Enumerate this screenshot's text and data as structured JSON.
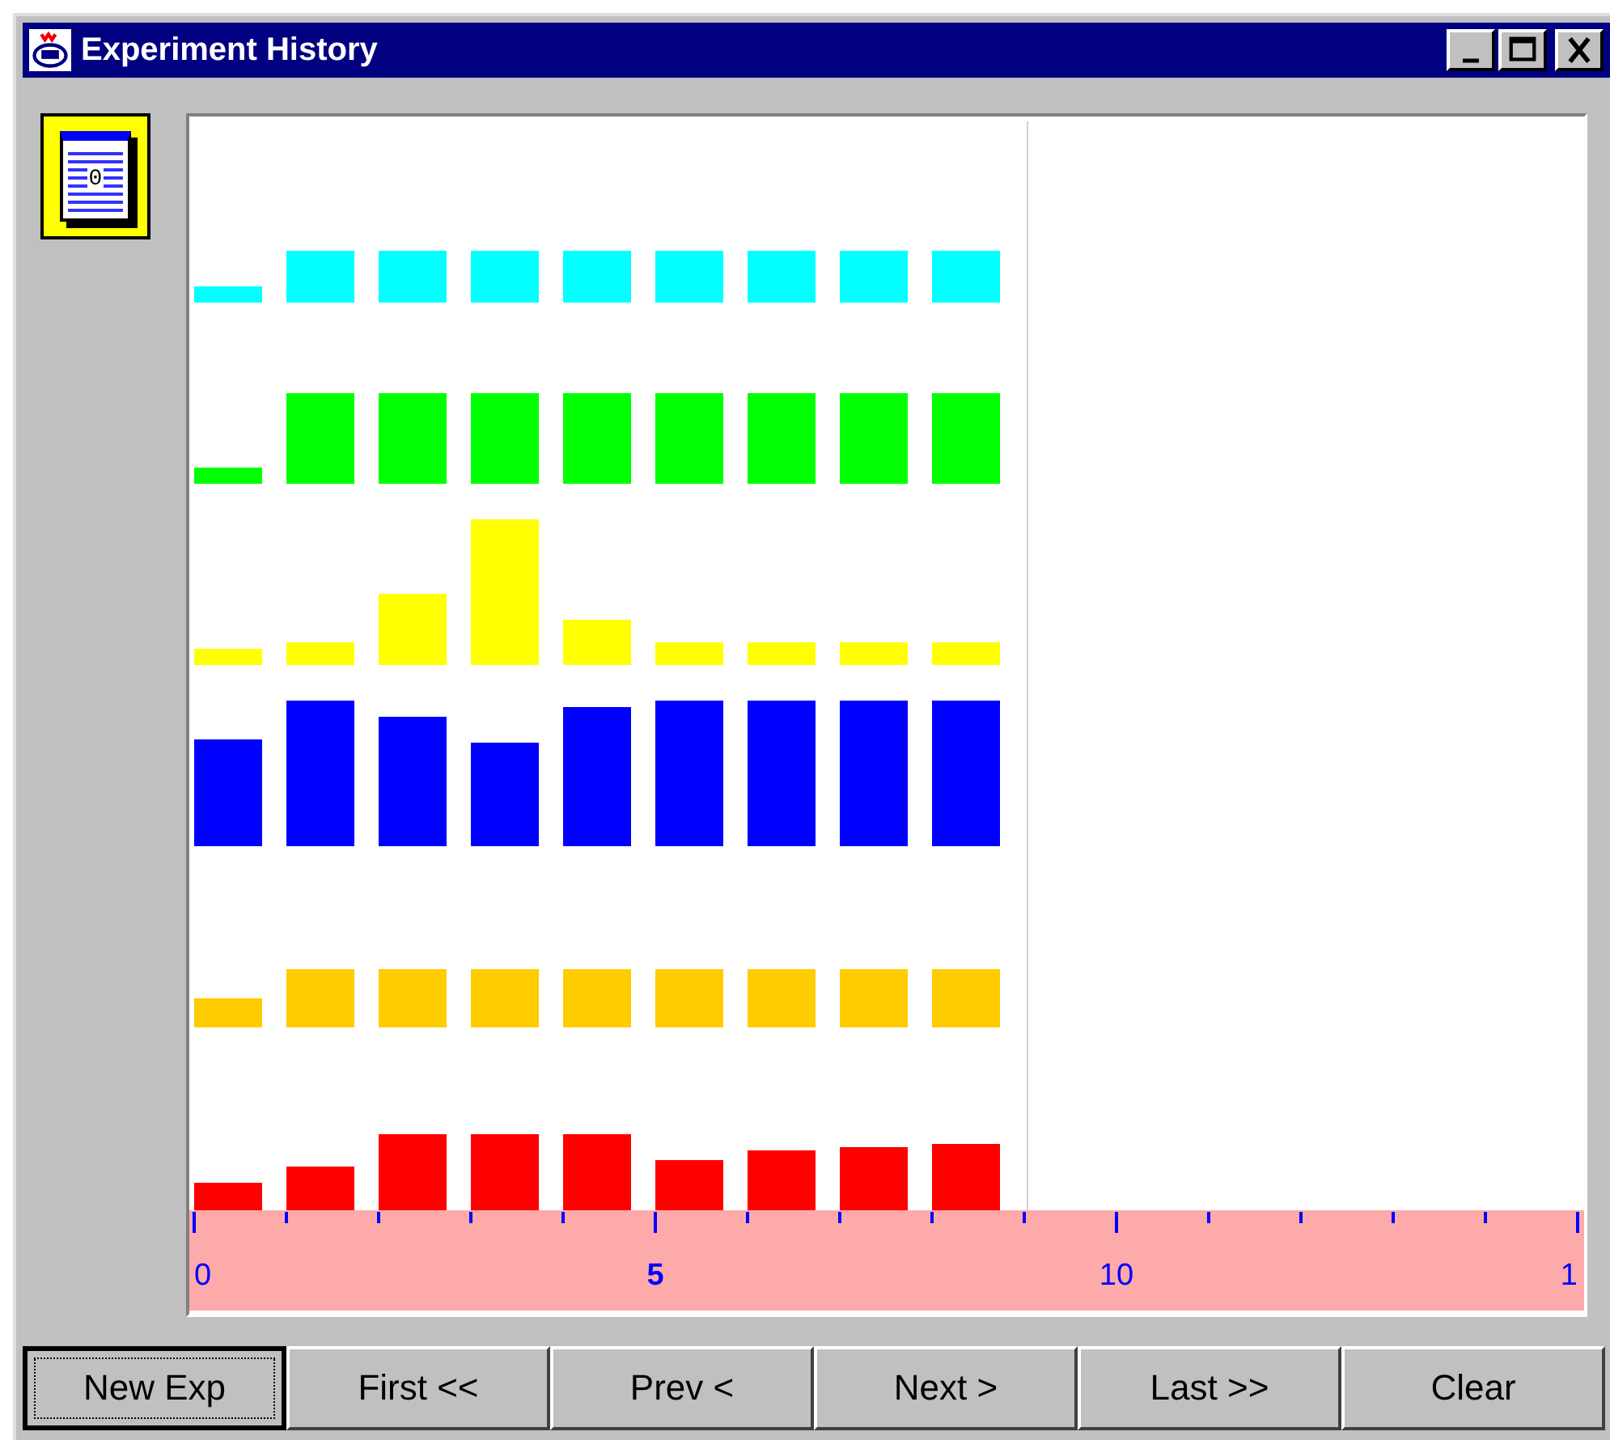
{
  "window": {
    "title": "Experiment History"
  },
  "notebook_icon": {
    "label": "0"
  },
  "chart": {
    "x_tick_labels": [
      {
        "label": "0"
      },
      {
        "label": "5"
      },
      {
        "label": "10"
      },
      {
        "label": "1"
      }
    ]
  },
  "buttons": [
    {
      "label": "New Exp",
      "focused": true
    },
    {
      "label": "First <<",
      "focused": false
    },
    {
      "label": "Prev <",
      "focused": false
    },
    {
      "label": "Next >",
      "focused": false
    },
    {
      "label": "Last >>",
      "focused": false
    },
    {
      "label": "Clear",
      "focused": false
    }
  ]
}
